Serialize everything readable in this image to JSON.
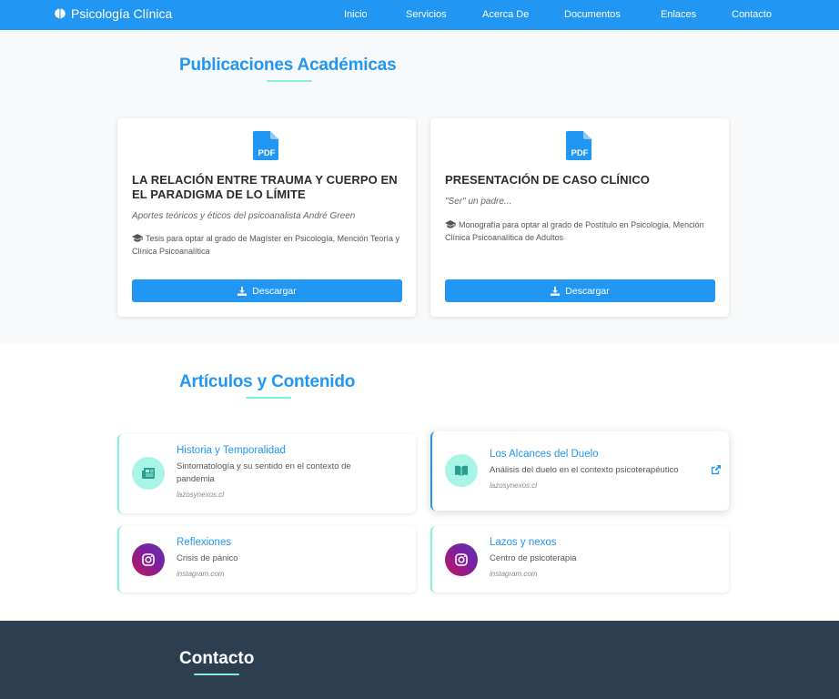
{
  "nav": {
    "brand": "Psicología Clínica",
    "links": [
      "Inicio",
      "Servicios",
      "Acerca De",
      "Documentos",
      "Enlaces",
      "Contacto"
    ]
  },
  "publications": {
    "title": "Publicaciones Académicas",
    "items": [
      {
        "icon": "pdf-icon",
        "title": "LA RELACIÓN ENTRE TRAUMA Y CUERPO EN EL PARADIGMA DE LO LÍMITE",
        "subtitle": "Aportes teóricos y éticos del psicoanalista André Green",
        "description": "Tesis para optar al grado de Magíster en Psicología, Mención Teoría y Clínica Psicoanalítica",
        "button": "Descargar"
      },
      {
        "icon": "pdf-icon",
        "title": "PRESENTACIÓN DE CASO CLÍNICO",
        "subtitle": "\"Ser\" un padre...",
        "description": "Monografía para optar al grado de Postítulo en Psicología, Mención Clínica Psicoanalítica de Adultos",
        "button": "Descargar"
      }
    ]
  },
  "articles": {
    "title": "Artículos y Contenido",
    "items": [
      {
        "icon": "newspaper-icon",
        "title": "Historia y Temporalidad",
        "description": "Sintomatología y su sentido en el contexto de pandemia",
        "source": "lazosynexos.cl"
      },
      {
        "icon": "book-open-icon",
        "title": "Los Alcances del Duelo",
        "description": "Análisis del duelo en el contexto psicoterapéutico",
        "source": "lazosynexos.cl"
      },
      {
        "icon": "instagram-icon",
        "title": "Reflexiones",
        "description": "Crisis de pánico",
        "source": "instagram.com"
      },
      {
        "icon": "instagram-icon",
        "title": "Lazos y nexos",
        "description": "Centro de psicoterapia",
        "source": "instagram.com"
      }
    ]
  },
  "contact": {
    "title": "Contacto"
  },
  "colors": {
    "primary": "#2196f3",
    "accent": "#7ef0dc",
    "footer": "#2c3e50"
  }
}
